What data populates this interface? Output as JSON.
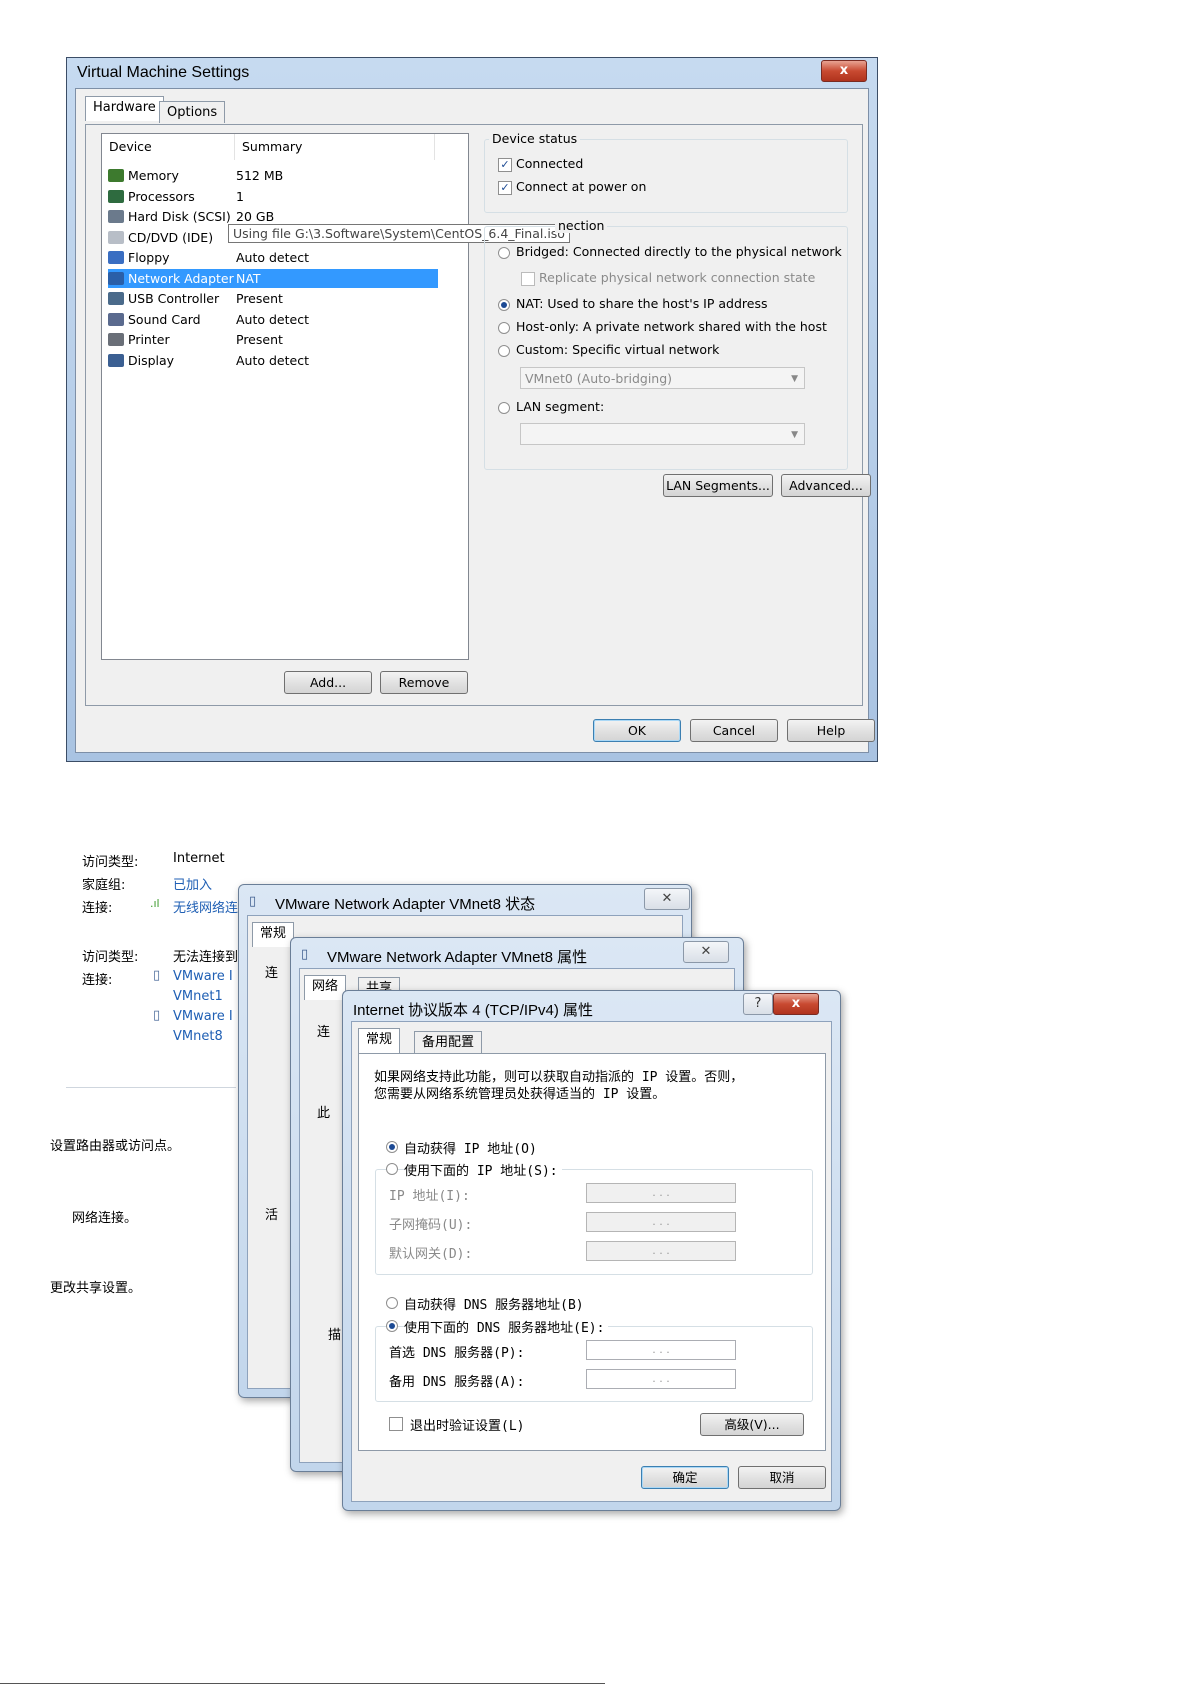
{
  "vm_dialog": {
    "title": "Virtual Machine Settings",
    "close_glyph": "x",
    "tabs": [
      "Hardware",
      "Options"
    ],
    "list_headers": {
      "device": "Device",
      "summary": "Summary"
    },
    "devices": [
      {
        "name": "Memory",
        "summary": "512 MB",
        "icon": "memory-icon",
        "color": "#3d7a2e"
      },
      {
        "name": "Processors",
        "summary": "1",
        "icon": "processor-icon",
        "color": "#2e6b3f"
      },
      {
        "name": "Hard Disk (SCSI)",
        "summary": "20 GB",
        "icon": "hard-disk-icon",
        "color": "#6b7a8c"
      },
      {
        "name": "CD/DVD (IDE)",
        "summary": "Using file G:\\3.Software\\System\\CentOS_6.4_Final.iso",
        "icon": "cd-dvd-icon",
        "color": "#b8bec7"
      },
      {
        "name": "Floppy",
        "summary": "Auto detect",
        "icon": "floppy-icon",
        "color": "#3a6ec2"
      },
      {
        "name": "Network Adapter",
        "summary": "NAT",
        "icon": "network-adapter-icon",
        "color": "#2a5fa8",
        "selected": true
      },
      {
        "name": "USB Controller",
        "summary": "Present",
        "icon": "usb-icon",
        "color": "#4a6a8a"
      },
      {
        "name": "Sound Card",
        "summary": "Auto detect",
        "icon": "sound-card-icon",
        "color": "#5a6a8e"
      },
      {
        "name": "Printer",
        "summary": "Present",
        "icon": "printer-icon",
        "color": "#6a6f78"
      },
      {
        "name": "Display",
        "summary": "Auto detect",
        "icon": "display-icon",
        "color": "#3b5f92"
      }
    ],
    "device_status": {
      "label": "Device status",
      "connected": "Connected",
      "connect_at_power_on": "Connect at power on"
    },
    "network_connection": {
      "label": "nection",
      "bridged": "Bridged: Connected directly to the physical network",
      "replicate": "Replicate physical network connection state",
      "nat": "NAT: Used to share the host's IP address",
      "host_only": "Host-only: A private network shared with the host",
      "custom": "Custom: Specific virtual network",
      "custom_value": "VMnet0 (Auto-bridging)",
      "lan_segment": "LAN segment:",
      "lan_segment_value": ""
    },
    "buttons": {
      "lan_segments": "LAN Segments...",
      "advanced": "Advanced...",
      "add": "Add...",
      "remove": "Remove",
      "ok": "OK",
      "cancel": "Cancel",
      "help": "Help"
    }
  },
  "network_center": {
    "block1": {
      "access_type_label": "访问类型:",
      "access_type": "Internet",
      "homegroup_label": "家庭组:",
      "homegroup": "已加入",
      "connection_label": "连接:",
      "connection": "无线网络连"
    },
    "block2": {
      "access_type_label": "访问类型:",
      "access_type": "无法连接到",
      "connection_label": "连接:",
      "vmnet1_a": "VMware I",
      "vmnet1_b": "VMnet1",
      "vmnet8_a": "VMware I",
      "vmnet8_b": "VMnet8"
    },
    "side_texts": [
      "设置路由器或访问点。",
      "网络连接。",
      "更改共享设置。"
    ]
  },
  "status_window": {
    "title": "VMware Network Adapter VMnet8 状态",
    "tab": "常规",
    "partial_texts": {
      "conn": "连",
      "active": "活"
    }
  },
  "properties_window": {
    "title": "VMware Network Adapter VMnet8 属性",
    "tabs": [
      "网络",
      "共享"
    ],
    "partial_texts": {
      "conn": "连",
      "this": "此",
      "install": "描"
    }
  },
  "ipv4_dialog": {
    "title": "Internet 协议版本 4 (TCP/IPv4) 属性",
    "help_glyph": "?",
    "close_glyph": "x",
    "tabs": [
      "常规",
      "备用配置"
    ],
    "intro_line1": "如果网络支持此功能，则可以获取自动指派的 IP 设置。否则，",
    "intro_line2": "您需要从网络系统管理员处获得适当的 IP 设置。",
    "auto_ip": "自动获得 IP 地址(O)",
    "manual_ip": "使用下面的 IP 地址(S):",
    "ip_address": "IP 地址(I):",
    "subnet_mask": "子网掩码(U):",
    "gateway": "默认网关(D):",
    "auto_dns": "自动获得 DNS 服务器地址(B)",
    "manual_dns": "使用下面的 DNS 服务器地址(E):",
    "preferred_dns": "首选 DNS 服务器(P):",
    "alternate_dns": "备用 DNS 服务器(A):",
    "ip_placeholder": ".   .   .",
    "validate_on_exit": "退出时验证设置(L)",
    "advanced": "高级(V)...",
    "ok": "确定",
    "cancel": "取消"
  }
}
